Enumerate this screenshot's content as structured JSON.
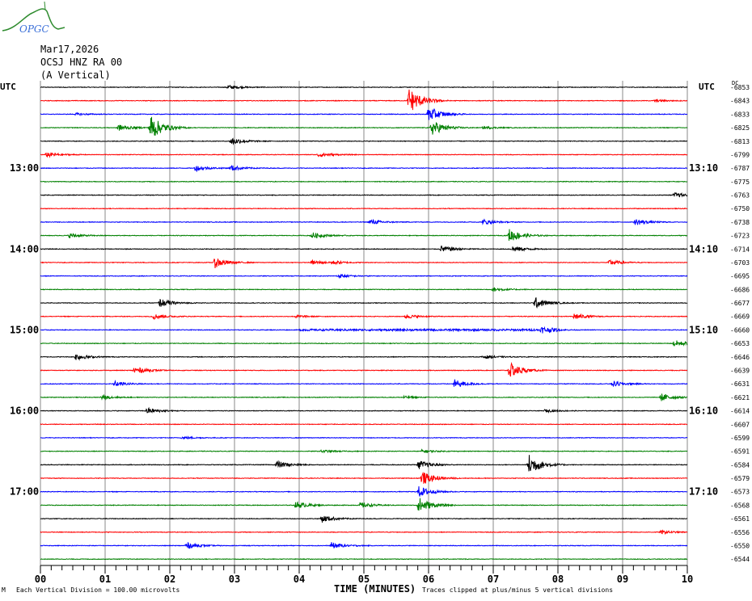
{
  "header": {
    "date": "Mar17,2026",
    "station": "OCSJ HNZ RA 00",
    "component": "(A Vertical)",
    "logo_text": "OPGC"
  },
  "footer": {
    "mark": "M",
    "scale_note": "Each Vertical Division =  100.00 microvolts",
    "clip_note": "Traces clipped at plus/minus 5 vertical divisions"
  },
  "chart_data": {
    "type": "line",
    "xlabel": "TIME (MINUTES)",
    "x_ticks": [
      "00",
      "01",
      "02",
      "03",
      "04",
      "05",
      "06",
      "07",
      "08",
      "09",
      "10"
    ],
    "xlim": [
      0,
      10
    ],
    "grid": true,
    "left_header": "UTC",
    "right_header": "UTC",
    "dc_header": "DC",
    "colors": [
      "#000000",
      "#ff0000",
      "#0000ff",
      "#008000"
    ],
    "left_time_labels": [
      {
        "trace": 6,
        "label": "13:00"
      },
      {
        "trace": 12,
        "label": "14:00"
      },
      {
        "trace": 18,
        "label": "15:00"
      },
      {
        "trace": 24,
        "label": "16:00"
      },
      {
        "trace": 30,
        "label": "17:00"
      }
    ],
    "right_time_labels": [
      {
        "trace": 6,
        "label": "13:10"
      },
      {
        "trace": 12,
        "label": "14:10"
      },
      {
        "trace": 18,
        "label": "15:10"
      },
      {
        "trace": 24,
        "label": "16:10"
      },
      {
        "trace": 30,
        "label": "17:10"
      }
    ],
    "dc_offsets": [
      "-6853",
      "-6843",
      "-6833",
      "-6825",
      "-6813",
      "-6799",
      "-6787",
      "-6775",
      "-6763",
      "-6750",
      "-6738",
      "-6723",
      "-6714",
      "-6703",
      "-6695",
      "-6686",
      "-6677",
      "-6669",
      "-6660",
      "-6653",
      "-6646",
      "-6639",
      "-6631",
      "-6621",
      "-6614",
      "-6607",
      "-6599",
      "-6591",
      "-6584",
      "-6579",
      "-6573",
      "-6568",
      "-6561",
      "-6556",
      "-6550",
      "-6544"
    ],
    "events_note_units": "minute, amplitude in vertical divisions",
    "events": [
      [
        [
          2.9,
          0.8
        ]
      ],
      [
        [
          5.7,
          5
        ],
        [
          9.5,
          0.4
        ]
      ],
      [
        [
          0.55,
          0.4
        ],
        [
          6.0,
          3
        ]
      ],
      [
        [
          1.2,
          1.2
        ],
        [
          1.7,
          5
        ],
        [
          6.05,
          3
        ],
        [
          6.85,
          0.5
        ]
      ],
      [
        [
          2.95,
          1.5
        ]
      ],
      [
        [
          0.1,
          1
        ],
        [
          4.3,
          1
        ]
      ],
      [
        [
          2.4,
          1
        ],
        [
          2.95,
          1
        ]
      ],
      [],
      [
        [
          9.8,
          0.9
        ]
      ],
      [],
      [
        [
          5.1,
          1
        ],
        [
          6.85,
          1
        ],
        [
          9.2,
          1.2
        ]
      ],
      [
        [
          0.45,
          0.9
        ],
        [
          4.2,
          1.2
        ],
        [
          7.25,
          2.5
        ]
      ],
      [
        [
          6.2,
          1.3
        ],
        [
          7.3,
          1.2
        ]
      ],
      [
        [
          2.7,
          2
        ],
        [
          4.2,
          0.8
        ],
        [
          4.5,
          0.6
        ],
        [
          8.8,
          1
        ]
      ],
      [
        [
          4.6,
          0.7
        ]
      ],
      [
        [
          7.0,
          0.8
        ]
      ],
      [
        [
          1.85,
          1.6
        ],
        [
          7.65,
          2
        ]
      ],
      [
        [
          1.75,
          1
        ],
        [
          3.95,
          0.5
        ],
        [
          5.65,
          0.8
        ],
        [
          8.25,
          1.2
        ]
      ],
      [
        [
          7.75,
          1
        ]
      ],
      [
        [
          9.8,
          1.2
        ]
      ],
      [
        [
          0.55,
          1.3
        ],
        [
          6.85,
          0.7
        ]
      ],
      [
        [
          1.45,
          1.4
        ],
        [
          7.25,
          3
        ]
      ],
      [
        [
          1.15,
          1
        ],
        [
          6.4,
          1.6
        ],
        [
          8.85,
          1.1
        ]
      ],
      [
        [
          0.95,
          0.8
        ],
        [
          5.6,
          0.5
        ],
        [
          9.6,
          1.4
        ]
      ],
      [
        [
          1.65,
          1.1
        ],
        [
          7.8,
          0.5
        ]
      ],
      [],
      [
        [
          2.2,
          0.5
        ]
      ],
      [
        [
          4.35,
          0.5
        ],
        [
          5.9,
          0.6
        ]
      ],
      [
        [
          3.65,
          1.5
        ],
        [
          5.85,
          1.6
        ],
        [
          7.55,
          4
        ]
      ],
      [
        [
          5.9,
          2.5
        ]
      ],
      [
        [
          5.85,
          2
        ]
      ],
      [
        [
          3.95,
          1.3
        ],
        [
          4.95,
          1
        ],
        [
          5.85,
          3
        ]
      ],
      [
        [
          4.35,
          1.4
        ]
      ],
      [
        [
          9.6,
          0.6
        ]
      ],
      [
        [
          2.25,
          1.2
        ],
        [
          4.5,
          1.2
        ]
      ],
      []
    ]
  }
}
